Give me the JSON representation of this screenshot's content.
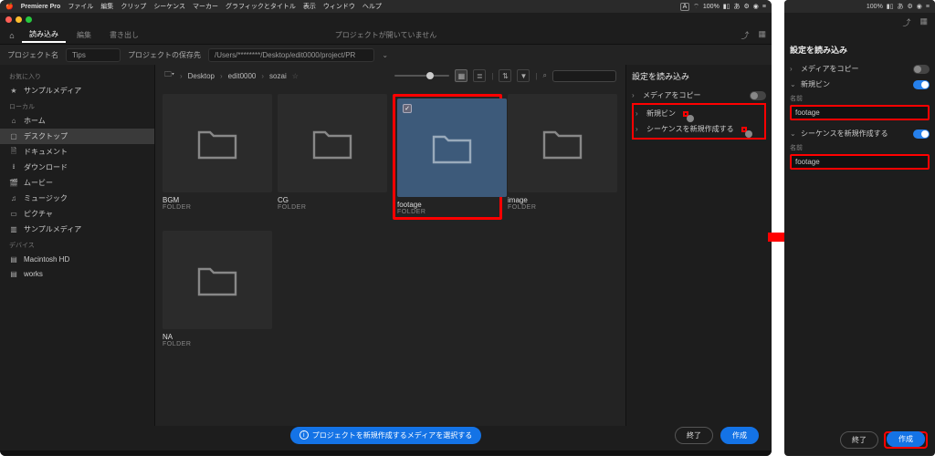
{
  "mac_menu": {
    "app": "Premiere Pro",
    "items": [
      "ファイル",
      "編集",
      "クリップ",
      "シーケンス",
      "マーカー",
      "グラフィックとタイトル",
      "表示",
      "ウィンドウ",
      "ヘルプ"
    ],
    "status": {
      "battery": "100%",
      "ime": "A",
      "extra": "あ"
    }
  },
  "app_tabs": {
    "tabs": [
      "読み込み",
      "編集",
      "書き出し"
    ],
    "active": 0,
    "title": "プロジェクトが開いていません"
  },
  "project_bar": {
    "label": "プロジェクト名",
    "value": "Tips",
    "save_label": "プロジェクトの保存先",
    "save_path": "/Users/********/Desktop/edit0000/project/PR"
  },
  "sidebar": {
    "sections": [
      {
        "title": "お気に入り",
        "items": [
          {
            "icon": "star",
            "label": "サンプルメディア"
          }
        ]
      },
      {
        "title": "ローカル",
        "items": [
          {
            "icon": "home",
            "label": "ホーム"
          },
          {
            "icon": "desktop",
            "label": "デスクトップ",
            "active": true
          },
          {
            "icon": "doc",
            "label": "ドキュメント"
          },
          {
            "icon": "download",
            "label": "ダウンロード"
          },
          {
            "icon": "video",
            "label": "ムービー"
          },
          {
            "icon": "music",
            "label": "ミュージック"
          },
          {
            "icon": "picture",
            "label": "ピクチャ"
          },
          {
            "icon": "sample",
            "label": "サンプルメディア"
          }
        ]
      },
      {
        "title": "デバイス",
        "items": [
          {
            "icon": "hd",
            "label": "Macintosh HD"
          },
          {
            "icon": "hd",
            "label": "works"
          }
        ]
      }
    ]
  },
  "breadcrumb": [
    "Desktop",
    "edit0000",
    "sozai"
  ],
  "media": {
    "folder_sub": "FOLDER",
    "items": [
      {
        "name": "BGM"
      },
      {
        "name": "CG"
      },
      {
        "name": "footage",
        "selected": true,
        "highlight": true
      },
      {
        "name": "image"
      },
      {
        "name": "NA"
      }
    ]
  },
  "settings_left": {
    "title": "設定を読み込み",
    "rows": [
      {
        "label": "メディアをコピー",
        "on": false,
        "chev": ">"
      },
      {
        "label": "新規ビン",
        "on": false,
        "chev": ">",
        "hl": true
      },
      {
        "label": "シーケンスを新規作成する",
        "on": false,
        "chev": ">",
        "hl": true
      }
    ]
  },
  "footer": {
    "hint": "プロジェクトを新規作成するメディアを選択する",
    "exit": "終了",
    "create": "作成"
  },
  "right_panel": {
    "status": {
      "battery": "100%"
    },
    "title": "設定を読み込み",
    "rows": [
      {
        "label": "メディアをコピー",
        "on": false,
        "chev": ">"
      },
      {
        "label": "新規ビン",
        "on": true,
        "chev": "v"
      }
    ],
    "name_label1": "名前",
    "name_value1": "footage",
    "seq": {
      "label": "シーケンスを新規作成する",
      "on": true,
      "chev": "v"
    },
    "name_label2": "名前",
    "name_value2": "footage",
    "exit": "終了",
    "create": "作成"
  }
}
